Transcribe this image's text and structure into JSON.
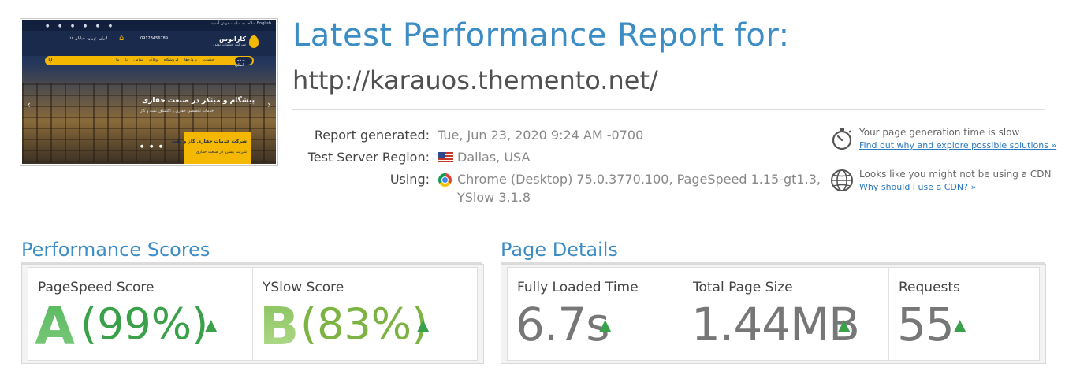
{
  "thumbnail": {
    "topbar_text": "سلام، به سایت خوش آمدید English",
    "logo_title": "کارانوس",
    "logo_subtitle": "شرکت خدمات نفتی",
    "phone": "09123456789",
    "address": "ایران، تهران، خیابان ۱۷",
    "nav_active": "صفحه اصلی",
    "nav_items": "خدمات  پروژه‌ها  فروشگاه  وبلاگ  تماس با ما",
    "hero_title": "پیشگام و مبتکر در صنعت حفاری",
    "hero_line": "خدمات تخصصی حفاری و اکتشاف نفت و گاز",
    "card_title": "شرکت خدمات حفاری گاز و نفت",
    "card_text": "شرکت پیشرو در صنعت حفاری"
  },
  "header": {
    "title": "Latest Performance Report for:",
    "url": "http://karauos.themento.net/"
  },
  "meta": {
    "report_generated_label": "Report generated:",
    "report_generated_value": "Tue, Jun 23, 2020 9:24 AM -0700",
    "region_label": "Test Server Region:",
    "region_value": "Dallas, USA",
    "using_label": "Using:",
    "using_value_line1": "Chrome (Desktop) 75.0.3770.100, PageSpeed 1.15-gt1.3,",
    "using_value_line2": "YSlow 3.1.8"
  },
  "tips": [
    {
      "text": "Your page generation time is slow",
      "link": "Find out why and explore possible solutions »",
      "icon": "stopwatch-icon"
    },
    {
      "text": "Looks like you might not be using a CDN",
      "link": "Why should I use a CDN? »",
      "icon": "globe-icon"
    }
  ],
  "performance": {
    "section_title": "Performance Scores",
    "pagespeed": {
      "label": "PageSpeed Score",
      "grade": "A",
      "percent": "(99%)",
      "color": "#3aa14a"
    },
    "yslow": {
      "label": "YSlow Score",
      "grade": "B",
      "percent": "(83%)",
      "color": "#7cb342"
    }
  },
  "details": {
    "section_title": "Page Details",
    "fully_loaded": {
      "label": "Fully Loaded Time",
      "value": "6.7s"
    },
    "page_size": {
      "label": "Total Page Size",
      "value": "1.44MB"
    },
    "requests": {
      "label": "Requests",
      "value": "55"
    }
  },
  "colors": {
    "accent": "#3c8dc5",
    "link": "#2a78c2",
    "good": "#3aa14a"
  }
}
